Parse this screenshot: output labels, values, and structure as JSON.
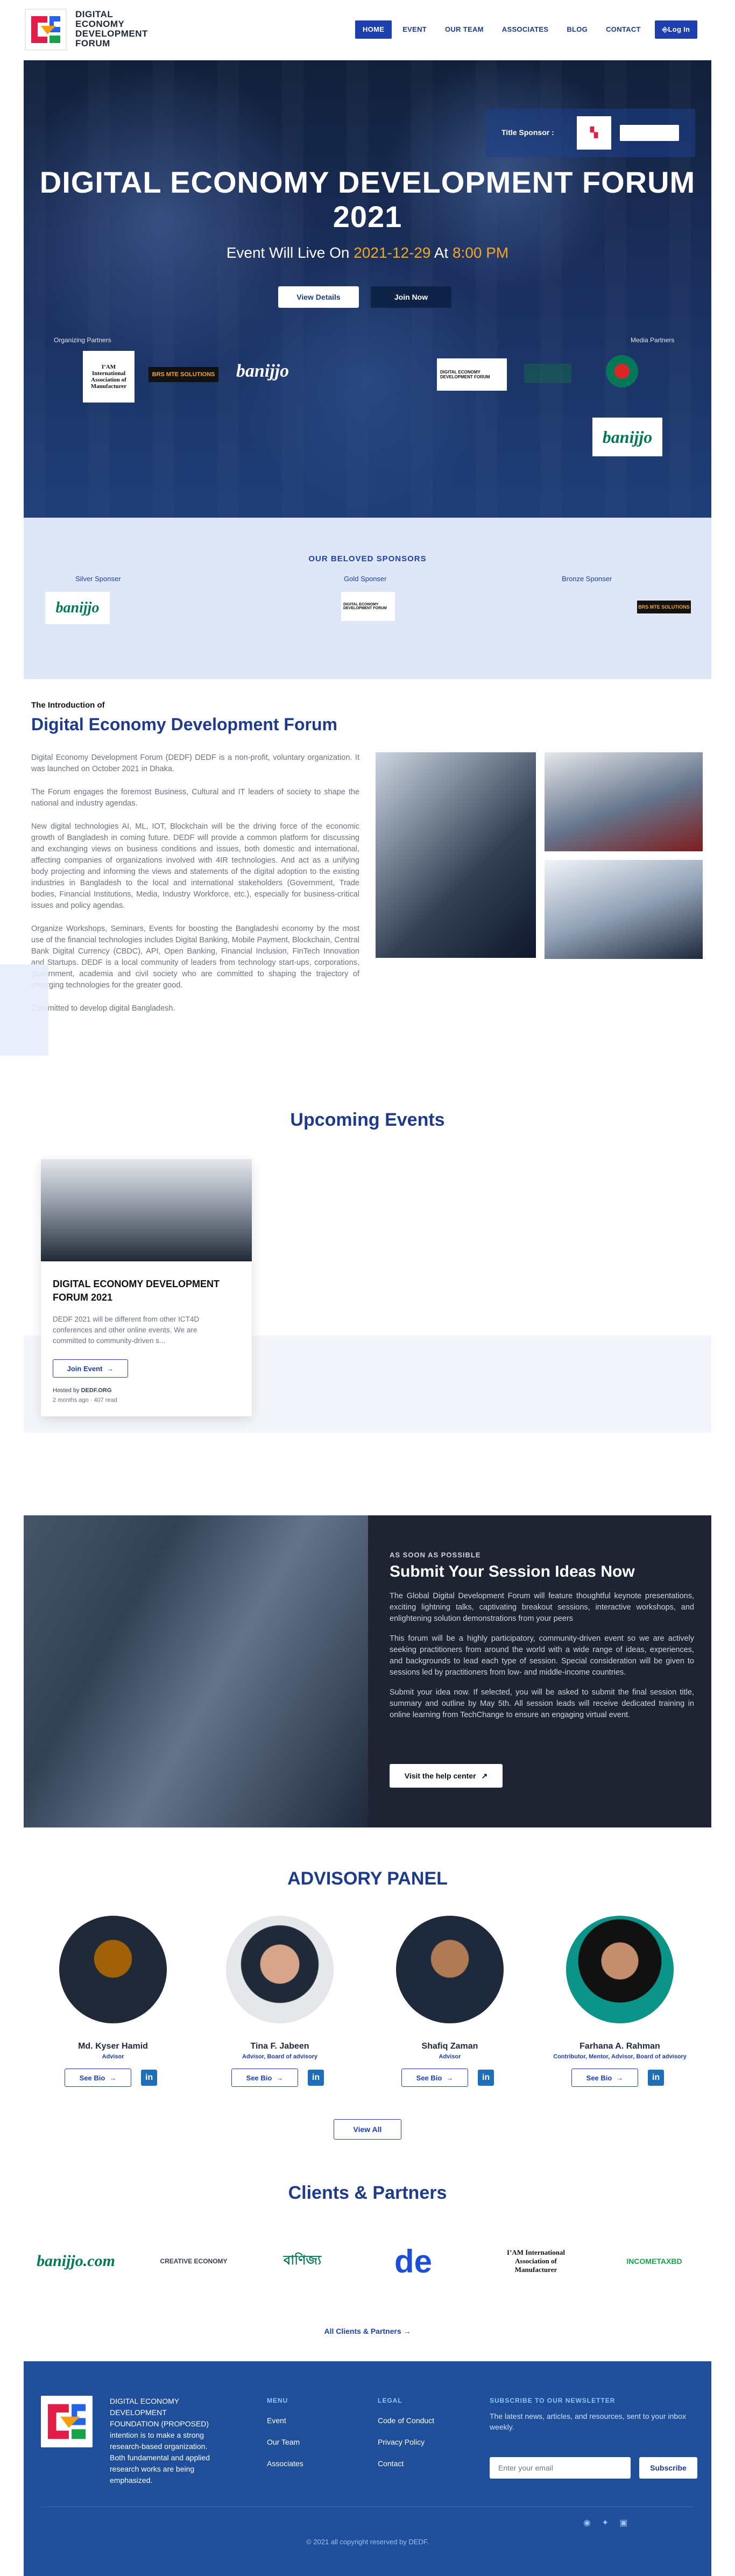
{
  "header": {
    "logo_text": [
      "DIGITAL",
      "ECONOMY",
      "DEVELOPMENT",
      "FORUM"
    ],
    "nav": [
      {
        "label": "HOME",
        "active": true
      },
      {
        "label": "EVENT"
      },
      {
        "label": "OUR TEAM"
      },
      {
        "label": "ASSOCIATES"
      },
      {
        "label": "BLOG"
      },
      {
        "label": "CONTACT"
      }
    ],
    "login_label": "Log In"
  },
  "hero": {
    "title_sponsor_label": "Title Sponsor :",
    "title": "DIGITAL ECONOMY DEVELOPMENT FORUM 2021",
    "live_prefix": "Event Will Live On",
    "live_date": "2021-12-29",
    "live_mid": "At",
    "live_time": "8:00 PM",
    "view_details": "View Details",
    "join_now": "Join Now",
    "organizing_label": "Organizing Partners",
    "media_label": "Media Partners",
    "partner_logos": [
      "I’AM International Association of Manufacturer",
      "BRS MTE SOLUTIONS",
      "banijjo",
      "DIGITAL ECONOMY DEVELOPMENT FORUM",
      "banijjo"
    ]
  },
  "beloved": {
    "heading": "OUR BELOVED SPONSORS",
    "tiers": [
      "Silver Sponser",
      "Gold Sponser",
      "Bronze Sponser"
    ],
    "logos": [
      "banijjo",
      "DIGITAL ECONOMY DEVELOPMENT FORUM",
      "BRS MTE SOLUTIONS"
    ]
  },
  "intro": {
    "eyebrow": "The Introduction of",
    "title": "Digital Economy Development Forum",
    "p1": "Digital Economy Development Forum (DEDF) DEDF is a non-profit, voluntary organization. It was launched on October 2021 in Dhaka.",
    "p2": "The Forum engages the foremost Business, Cultural and IT leaders of society to shape the national and industry agendas.",
    "p3": "New digital technologies AI, ML, IOT, Blockchain will be the driving force of the economic growth of Bangladesh in coming future. DEDF will provide a common platform for discussing and exchanging views on business conditions and issues, both domestic and international, affecting companies of organizations involved with 4IR technologies. And act as a unifying body projecting and informing the views and statements of the digital adoption to the existing industries in Bangladesh to the local and international stakeholders (Government, Trade bodies, Financial Institutions, Media, Industry Workforce, etc.), especially for business-critical issues and policy agendas.",
    "p4": "Organize Workshops, Seminars, Events for boosting the Bangladeshi economy by the most use of the financial technologies includes Digital Banking, Mobile Payment, Blockchain, Central Bank Digital Currency (CBDC), API, Open Banking, Financial Inclusion, FinTech Innovation and Startups. DEDF is a local community of leaders from technology start-ups, corporations, government, academia and civil society who are committed to shaping the trajectory of emerging technologies for the greater good.",
    "p5": "Committed to develop digital Bangladesh."
  },
  "events": {
    "heading": "Upcoming Events",
    "card": {
      "title": "DIGITAL ECONOMY DEVELOPMENT FORUM 2021",
      "excerpt": "DEDF 2021 will be different from other ICT4D conferences and other online events. We are committed to community-driven s...",
      "button": "Join Event",
      "hosted_label": "Hosted by",
      "hosted_by": "DEDF.ORG",
      "meta": "2 months ago · 407 read"
    }
  },
  "session": {
    "eyebrow": "AS SOON AS POSSIBLE",
    "title": "Submit Your Session Ideas Now",
    "p1": "The Global Digital Development Forum will feature thoughtful keynote presentations, exciting lightning talks, captivating breakout sessions, interactive workshops, and enlightening solution demonstrations from your peers",
    "p2": "This forum will be a highly participatory, community-driven event so we are actively seeking practitioners from around the world with a wide range of ideas, experiences, and backgrounds to lead each type of session. Special consideration will be given to sessions led by practitioners from low- and middle-income countries.",
    "p3": "Submit your idea now. If selected, you will be asked to submit the final session title, summary and outline by May 5th. All session leads will receive dedicated training in online learning from TechChange to ensure an engaging virtual event.",
    "button": "Visit the help center"
  },
  "advisory": {
    "heading": "ADVISORY PANEL",
    "members": [
      {
        "name": "Md. Kyser Hamid",
        "role": "Advisor"
      },
      {
        "name": "Tina F. Jabeen",
        "role": "Advisor, Board of advisory"
      },
      {
        "name": "Shafiq Zaman",
        "role": "Advisor"
      },
      {
        "name": "Farhana A. Rahman",
        "role": "Contributor, Mentor, Advisor, Board of advisory"
      }
    ],
    "bio_label": "See Bio",
    "view_all": "View All"
  },
  "clients": {
    "heading": "Clients & Partners",
    "logos": [
      "banijjo.com",
      "CREATIVE ECONOMY",
      "বাণিজ্য",
      "de",
      "I’AM International Association of Manufacturer",
      "INCOMETAXBD"
    ],
    "all_link": "All Clients & Partners"
  },
  "footer": {
    "about": "DIGITAL ECONOMY DEVELOPMENT FOUNDATION (PROPOSED) intention is to make a strong research-based organization. Both fundamental and applied research works are being emphasized.",
    "menu_heading": "MENU",
    "menu": [
      "Event",
      "Our Team",
      "Associates"
    ],
    "legal_heading": "LEGAL",
    "legal": [
      "Code of Conduct",
      "Privacy Policy",
      "Contact"
    ],
    "newsletter_heading": "SUBSCRIBE TO OUR NEWSLETTER",
    "newsletter_text": "The latest news, articles, and resources, sent to your inbox weekly.",
    "email_placeholder": "Enter your email",
    "subscribe": "Subscribe",
    "copyright": "© 2021 all copyright reserved by DEDF."
  }
}
